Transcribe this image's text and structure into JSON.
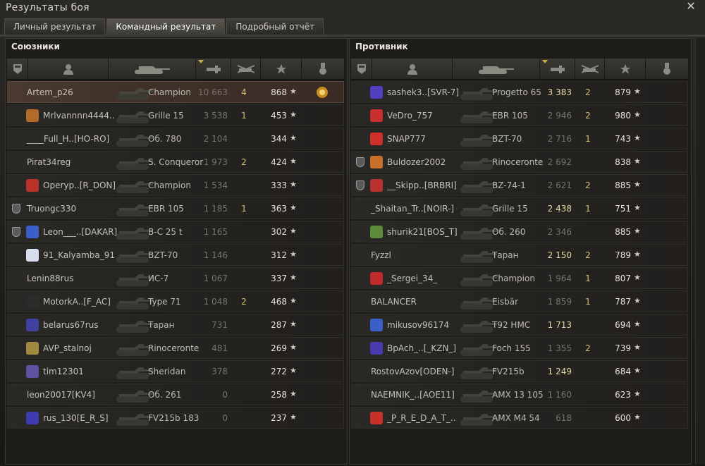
{
  "window": {
    "title": "Результаты боя"
  },
  "tabs": [
    {
      "label": "Личный результат"
    },
    {
      "label": "Командный результат"
    },
    {
      "label": "Подробный отчёт"
    }
  ],
  "allies": {
    "title": "Союзники",
    "rows": [
      {
        "nick": "Artem_p26",
        "tank": "Champion",
        "dmg": "10 663",
        "kills": "4",
        "xp": "868",
        "self": true,
        "clan_color": "",
        "medal": true
      },
      {
        "nick": "Mrlvannnn4444..",
        "tank": "Grille 15",
        "dmg": "3 538",
        "kills": "1",
        "xp": "453",
        "clan_color": "#b36b2a"
      },
      {
        "nick": "____Full_H..[HO-RO]",
        "tank": "Об. 780",
        "dmg": "2 104",
        "kills": "",
        "xp": "344"
      },
      {
        "nick": "Pirat34reg",
        "tank": "S. Conqueror",
        "dmg": "1 973",
        "kills": "2",
        "xp": "424"
      },
      {
        "nick": "Operyp..[R_DON]",
        "tank": "Champion",
        "dmg": "1 534",
        "kills": "",
        "xp": "333",
        "clan_color": "#b8322a"
      },
      {
        "nick": "Truongc330",
        "tank": "EBR 105",
        "dmg": "1 185",
        "kills": "1",
        "xp": "363",
        "squad": true
      },
      {
        "nick": "Leon___..[DAKAR]",
        "tank": "B-C 25 t",
        "dmg": "1 165",
        "kills": "",
        "xp": "302",
        "squad": true,
        "clan_color": "#3a5fc8"
      },
      {
        "nick": "91_Kalyamba_91",
        "tank": "BZT-70",
        "dmg": "1 146",
        "kills": "",
        "xp": "312",
        "clan_color": "#d8dcec"
      },
      {
        "nick": "Lenin88rus",
        "tank": "ИС-7",
        "dmg": "1 067",
        "kills": "",
        "xp": "337"
      },
      {
        "nick": "MotorkA..[F_AC]",
        "tank": "Type 71",
        "dmg": "1 048",
        "kills": "2",
        "xp": "468",
        "clan_color": "#2b2b2b"
      },
      {
        "nick": "belarus67rus",
        "tank": "Таран",
        "dmg": "731",
        "kills": "",
        "xp": "287",
        "clan_color": "#4040a0"
      },
      {
        "nick": "AVP_stalnoj",
        "tank": "Rinoceronte",
        "dmg": "481",
        "kills": "",
        "xp": "269",
        "clan_color": "#a08a40"
      },
      {
        "nick": "tim12301",
        "tank": "Sheridan",
        "dmg": "378",
        "kills": "",
        "xp": "272",
        "clan_color": "#6050a0"
      },
      {
        "nick": "leon20017[KV4]",
        "tank": "Об. 261",
        "dmg": "0",
        "kills": "",
        "xp": "258"
      },
      {
        "nick": "rus_130[E_R_S]",
        "tank": "FV215b 183",
        "dmg": "0",
        "kills": "",
        "xp": "237",
        "clan_color": "#3c3cb0"
      }
    ]
  },
  "enemies": {
    "title": "Противник",
    "rows": [
      {
        "nick": "sashek3..[SVR-7]",
        "tank": "Progetto 65",
        "dmg": "3 383",
        "kills": "2",
        "xp": "879",
        "clan_color": "#5040c0",
        "hi": true
      },
      {
        "nick": "VeDro_757",
        "tank": "EBR 105",
        "dmg": "2 946",
        "kills": "2",
        "xp": "980",
        "clan_color": "#c83030"
      },
      {
        "nick": "SNAP777",
        "tank": "BZT-70",
        "dmg": "2 716",
        "kills": "1",
        "xp": "743",
        "clan_color": "#d0302a"
      },
      {
        "nick": "Buldozer2002",
        "tank": "Rinoceronte",
        "dmg": "2 692",
        "kills": "",
        "xp": "838",
        "squad": true,
        "clan_color": "#c8702a"
      },
      {
        "nick": "__Skipp..[BRBRI]",
        "tank": "BZ-74-1",
        "dmg": "2 621",
        "kills": "2",
        "xp": "885",
        "squad": true,
        "clan_color": "#b83030"
      },
      {
        "nick": "_Shaitan_Tr..[NOIR-]",
        "tank": "Grille 15",
        "dmg": "2 438",
        "kills": "1",
        "xp": "751",
        "hi": true
      },
      {
        "nick": "shurik21[BOS_T]",
        "tank": "Об. 260",
        "dmg": "2 346",
        "kills": "",
        "xp": "885",
        "clan_color": "#5a8a3a"
      },
      {
        "nick": "Fyzzl",
        "tank": "Таран",
        "dmg": "2 150",
        "kills": "2",
        "xp": "789",
        "hi": true
      },
      {
        "nick": "_Sergei_34_",
        "tank": "Champion",
        "dmg": "1 964",
        "kills": "1",
        "xp": "807",
        "clan_color": "#c02a2a"
      },
      {
        "nick": "BALANCER",
        "tank": "Eisbär",
        "dmg": "1 859",
        "kills": "1",
        "xp": "787"
      },
      {
        "nick": "mikusov96174",
        "tank": "T92 HMC",
        "dmg": "1 713",
        "kills": "",
        "xp": "694",
        "clan_color": "#3a5fc8",
        "hi": true
      },
      {
        "nick": "BpAch_..[_KZN_]",
        "tank": "Foch 155",
        "dmg": "1 355",
        "kills": "2",
        "xp": "739",
        "clan_color": "#4a3ab0"
      },
      {
        "nick": "RostovAzov[ODEN-]",
        "tank": "FV215b",
        "dmg": "1 249",
        "kills": "",
        "xp": "684",
        "hi": true
      },
      {
        "nick": "NAEMNIK_..[AOE11]",
        "tank": "AMX 13 105",
        "dmg": "1 160",
        "kills": "",
        "xp": "623"
      },
      {
        "nick": "_P_R_E_D_A_T_..",
        "tank": "AMX M4 54",
        "dmg": "618",
        "kills": "",
        "xp": "600",
        "clan_color": "#c8302a"
      }
    ]
  },
  "icons": {
    "close": "close-icon",
    "star": "★"
  }
}
